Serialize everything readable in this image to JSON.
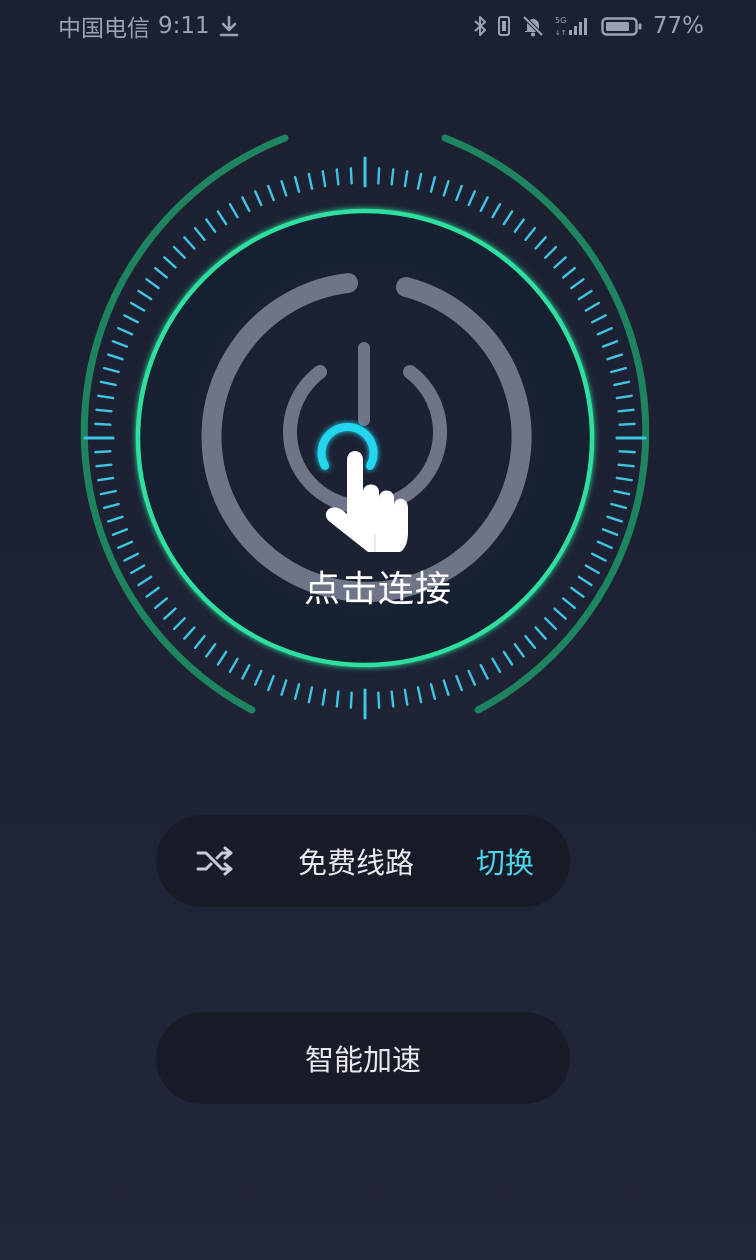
{
  "status_bar": {
    "carrier": "中国电信",
    "time": "9:11",
    "battery": "77%",
    "icons": [
      "download-icon",
      "bluetooth-icon",
      "vibrate-icon",
      "silent-bell-icon",
      "5g-signal-icon",
      "battery-icon"
    ]
  },
  "hero": {
    "connect_label": "点击连接",
    "icons": [
      "power-icon",
      "tap-hand-icon"
    ],
    "colors": {
      "outer_arc": "#1e8a62",
      "ticks": "#3ec5e2",
      "inner_ring": "#2fe0a0",
      "power": "#6f7588",
      "tap_ring": "#22d6f0"
    }
  },
  "route": {
    "icon": "shuffle-icon",
    "label": "免费线路",
    "switch_label": "切换"
  },
  "smart": {
    "label": "智能加速"
  }
}
